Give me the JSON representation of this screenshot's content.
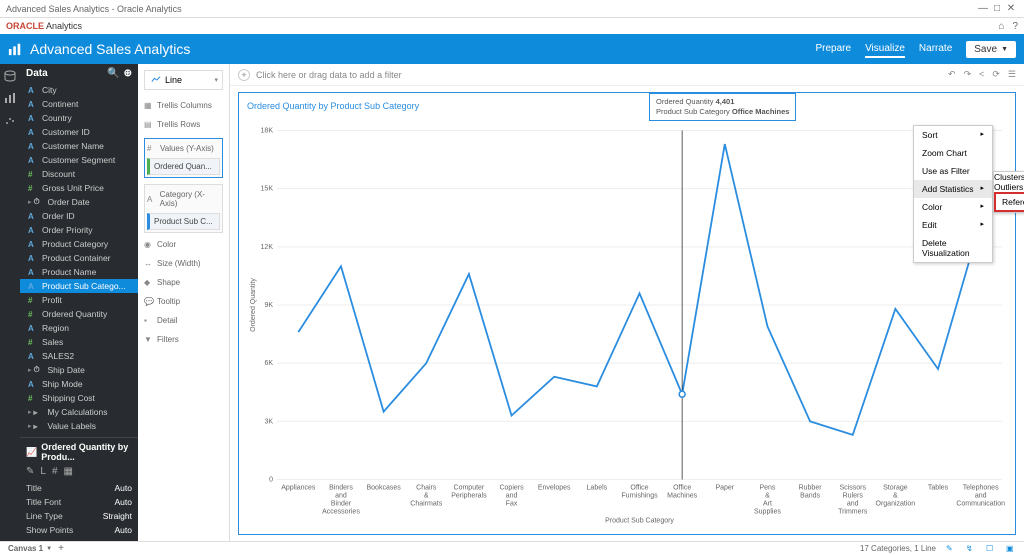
{
  "window": {
    "title": "Advanced Sales Analytics - Oracle Analytics"
  },
  "brand": {
    "name_a": "ORACLE",
    "name_b": " Analytics"
  },
  "header": {
    "title": "Advanced Sales Analytics",
    "tabs": {
      "prepare": "Prepare",
      "visualize": "Visualize",
      "narrate": "Narrate"
    },
    "save": "Save"
  },
  "sidebar": {
    "title": "Data",
    "items": [
      {
        "icon": "A",
        "label": "City"
      },
      {
        "icon": "A",
        "label": "Continent"
      },
      {
        "icon": "A",
        "label": "Country"
      },
      {
        "icon": "A",
        "label": "Customer ID"
      },
      {
        "icon": "A",
        "label": "Customer Name"
      },
      {
        "icon": "A",
        "label": "Customer Segment"
      },
      {
        "icon": "#",
        "label": "Discount",
        "green": true
      },
      {
        "icon": "#",
        "label": "Gross Unit Price",
        "green": true
      },
      {
        "icon": "⏱",
        "label": "Order Date",
        "caret": true,
        "grey": true
      },
      {
        "icon": "A",
        "label": "Order ID"
      },
      {
        "icon": "A",
        "label": "Order Priority"
      },
      {
        "icon": "A",
        "label": "Product Category"
      },
      {
        "icon": "A",
        "label": "Product Container"
      },
      {
        "icon": "A",
        "label": "Product Name"
      },
      {
        "icon": "A",
        "label": "Product Sub Catego...",
        "active": true
      },
      {
        "icon": "#",
        "label": "Profit",
        "green": true
      },
      {
        "icon": "#",
        "label": "Ordered Quantity",
        "green": true
      },
      {
        "icon": "A",
        "label": "Region"
      },
      {
        "icon": "#",
        "label": "Sales",
        "green": true
      },
      {
        "icon": "A",
        "label": "SALES2"
      },
      {
        "icon": "⏱",
        "label": "Ship Date",
        "caret": true,
        "grey": true
      },
      {
        "icon": "A",
        "label": "Ship Mode"
      },
      {
        "icon": "#",
        "label": "Shipping Cost",
        "green": true
      },
      {
        "icon": "▸",
        "label": "My Calculations",
        "caret": true,
        "grey": true
      },
      {
        "icon": "▸",
        "label": "Value Labels",
        "caret": true,
        "grey": true
      }
    ]
  },
  "props": {
    "title": "Ordered Quantity by Produ...",
    "rows": [
      {
        "label": "Title",
        "value": "Auto"
      },
      {
        "label": "Title Font",
        "value": "Auto"
      },
      {
        "label": "Line Type",
        "value": "Straight"
      },
      {
        "label": "Show Points",
        "value": "Auto"
      }
    ]
  },
  "grammar": {
    "viz_type": "Line",
    "shelves": {
      "trellis_cols": "Trellis Columns",
      "trellis_rows": "Trellis Rows",
      "values": "Values (Y-Axis)",
      "values_chip": "Ordered Quan...",
      "category": "Category (X-Axis)",
      "category_chip": "Product Sub C...",
      "color": "Color",
      "size": "Size (Width)",
      "shape": "Shape",
      "tooltip": "Tooltip",
      "detail": "Detail",
      "filters": "Filters"
    }
  },
  "filterbar": {
    "hint": "Click here or drag data to add a filter"
  },
  "chart": {
    "title": "Ordered Quantity by Product Sub Category",
    "tooltip_l1a": "Ordered Quantity ",
    "tooltip_l1b": "4,401",
    "tooltip_l2a": "Product Sub Category ",
    "tooltip_l2b": "Office Machines",
    "ylabel": "Ordered Quantity",
    "xlabel": "Product Sub Category"
  },
  "context_menu": {
    "items": [
      "Sort",
      "Zoom Chart",
      "Use as Filter",
      "Add Statistics",
      "Color",
      "Edit",
      "Delete Visualization"
    ],
    "sub": [
      "Clusters",
      "Outliers",
      "Reference Line"
    ]
  },
  "footer": {
    "canvas": "Canvas 1",
    "status": "17 Categories, 1 Line"
  },
  "chart_data": {
    "type": "line",
    "title": "Ordered Quantity by Product Sub Category",
    "xlabel": "Product Sub Category",
    "ylabel": "Ordered Quantity",
    "ylim": [
      0,
      18000
    ],
    "categories": [
      "Appliances",
      "Binders and Binder Accessories",
      "Bookcases",
      "Chairs & Chairmats",
      "Computer Peripherals",
      "Copiers and Fax",
      "Envelopes",
      "Labels",
      "Office Furnishings",
      "Office Machines",
      "Paper",
      "Pens & Art Supplies",
      "Rubber Bands",
      "Scissors Rulers and Trimmers",
      "Storage & Organization",
      "Tables",
      "Telephones and Communication"
    ],
    "values": [
      7600,
      11000,
      3500,
      6000,
      10600,
      3300,
      5300,
      4800,
      9600,
      4401,
      17300,
      7900,
      3000,
      2300,
      8800,
      5700,
      13300
    ]
  }
}
